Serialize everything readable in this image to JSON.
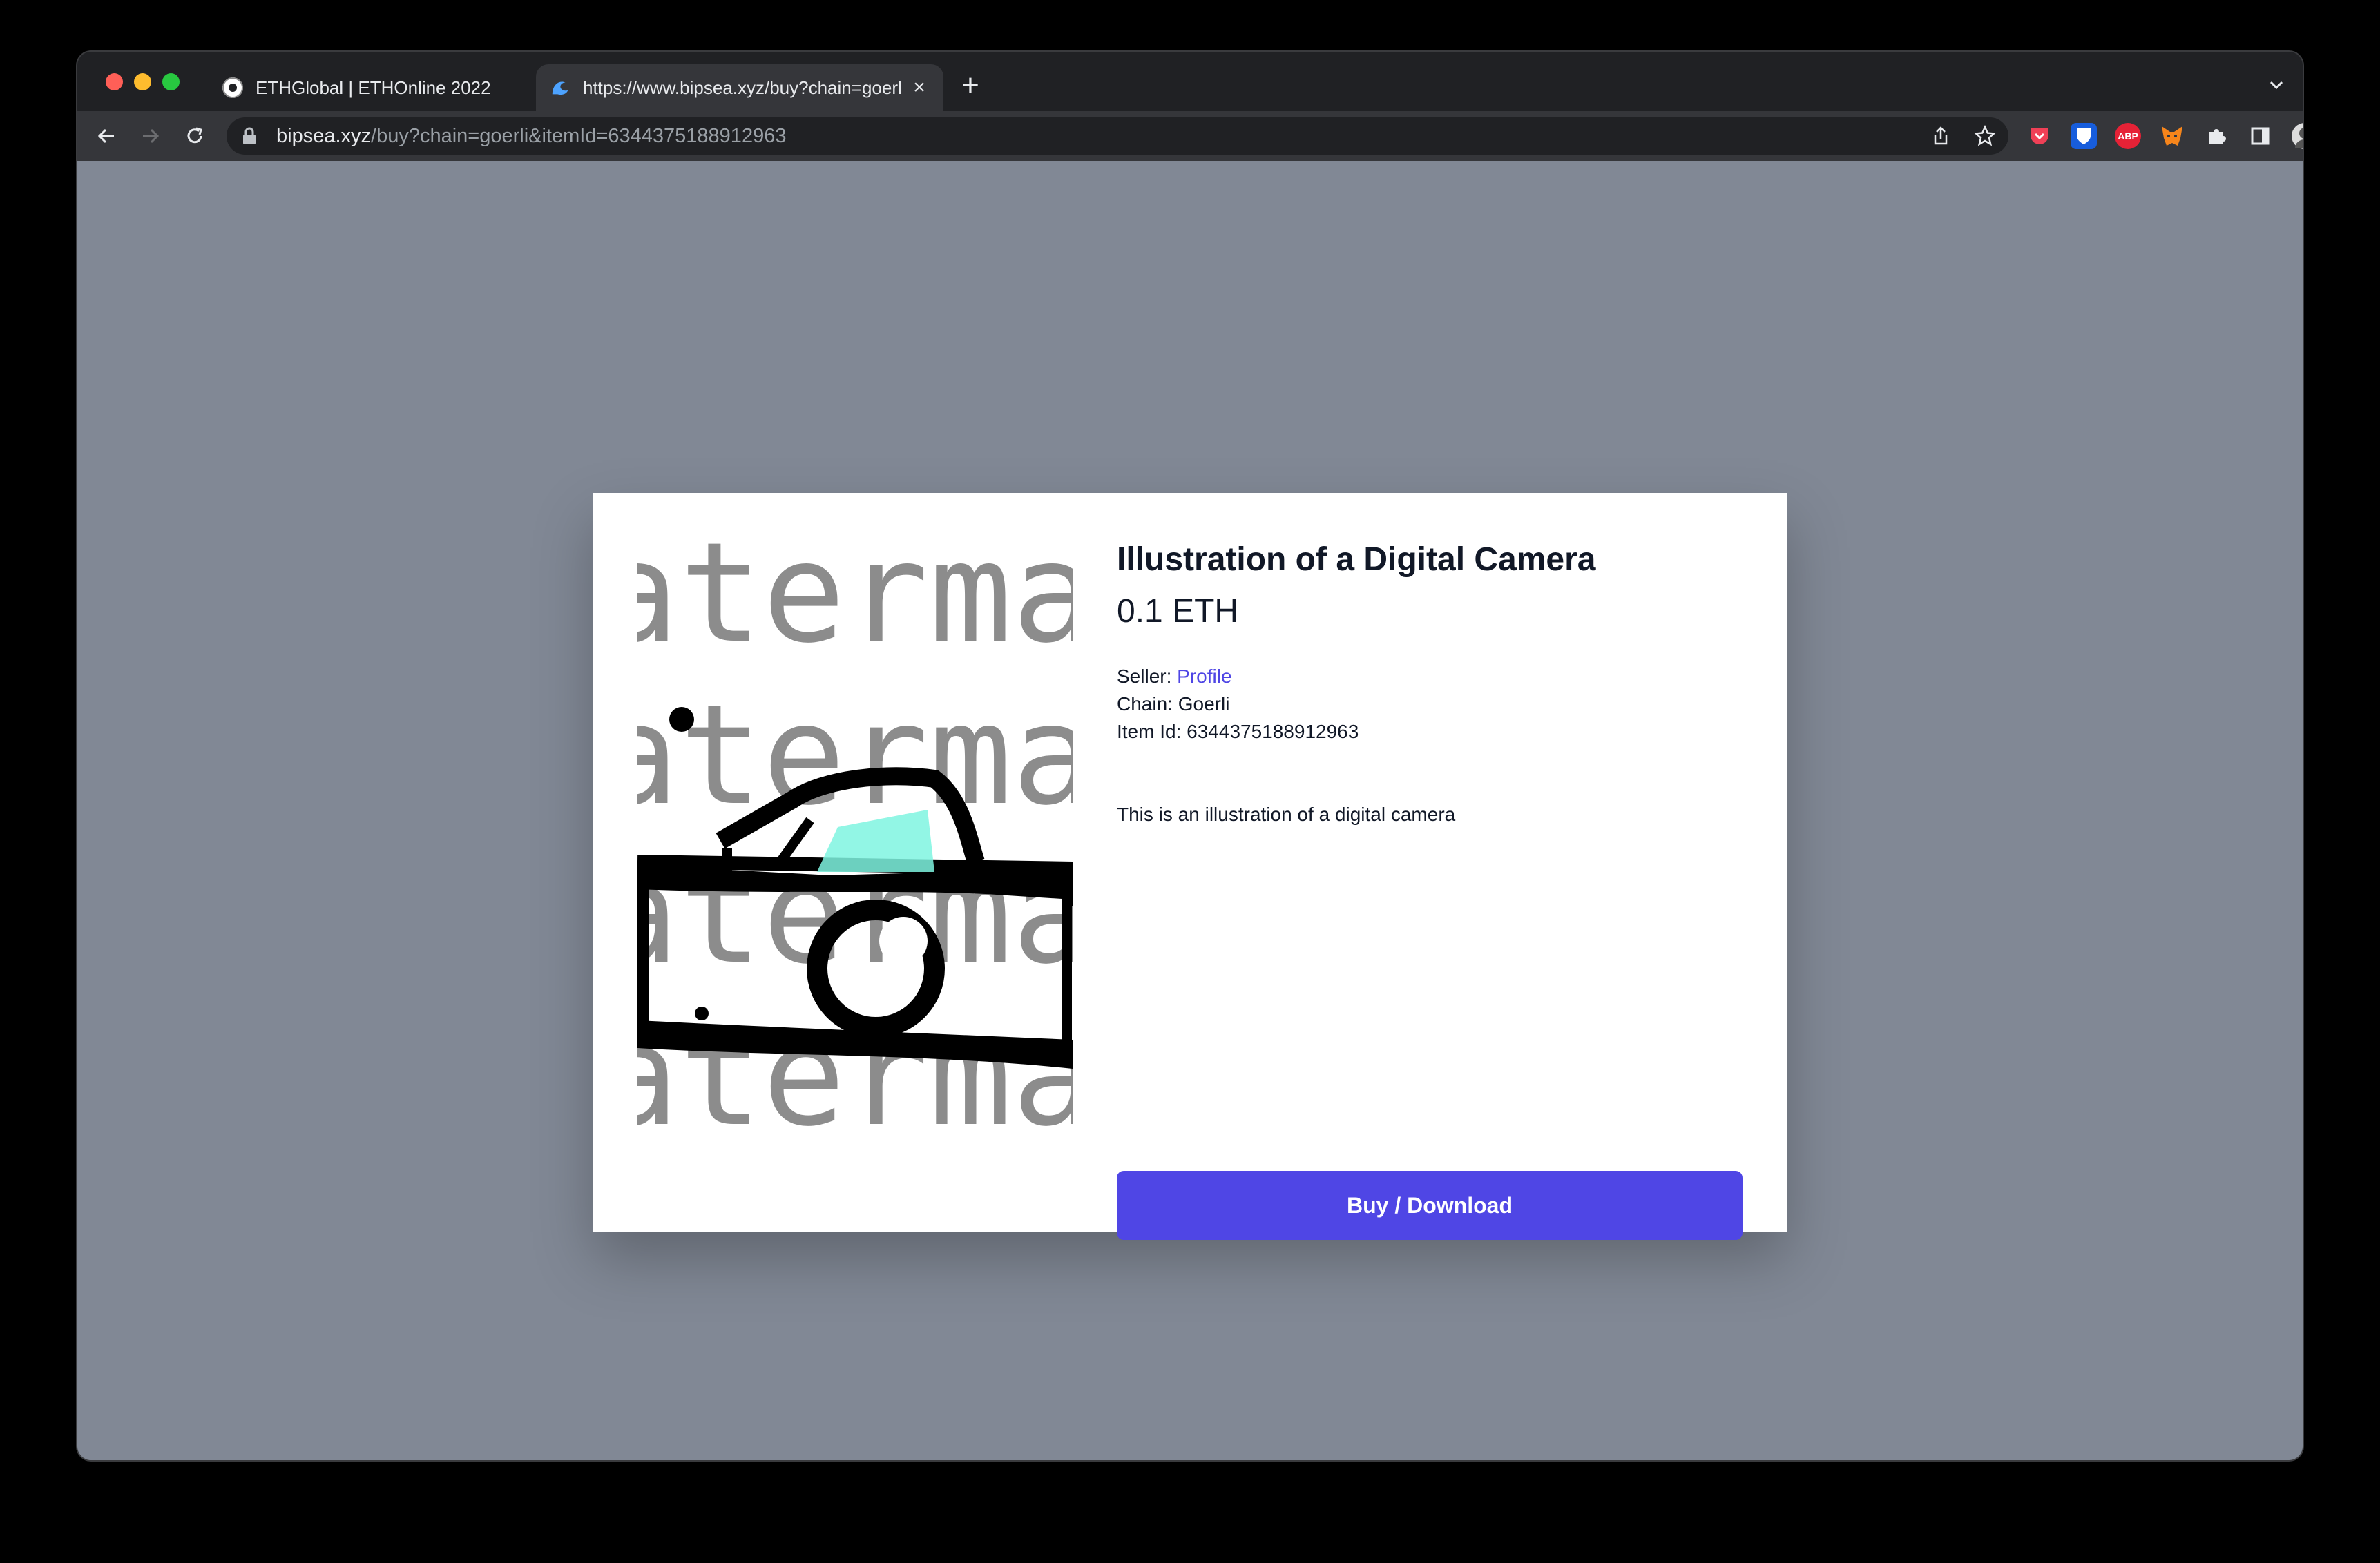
{
  "browser": {
    "tabs": [
      {
        "title": "ETHGlobal | ETHOnline 2022",
        "favicon": "ethglobal-icon",
        "active": false
      },
      {
        "title": "https://www.bipsea.xyz/buy?chain=goerli&itemId=6344375188912963",
        "favicon": "wave-icon",
        "active": true
      }
    ],
    "url_host": "bipsea.xyz",
    "url_path": "/buy?chain=goerli&itemId=6344375188912963",
    "extensions": [
      {
        "name": "pocket-icon",
        "color": "#ef4056"
      },
      {
        "name": "bitwarden-icon",
        "color": "#175ddc"
      },
      {
        "name": "adblock-icon",
        "color": "#e62236",
        "label": "ABP"
      },
      {
        "name": "metamask-icon",
        "color": "#f6851b"
      }
    ]
  },
  "item": {
    "image_watermark": "aterma",
    "title": "Illustration of a Digital Camera",
    "price": "0.1 ETH",
    "seller_label": "Seller:",
    "seller_link": "Profile",
    "chain_label": "Chain:",
    "chain_value": "Goerli",
    "item_id_label": "Item Id:",
    "item_id_value": "6344375188912963",
    "description": "This is an illustration of a digital camera",
    "buy_button": "Buy / Download"
  },
  "colors": {
    "accent": "#4f46e5",
    "link": "#4f46e5",
    "backdrop": "#9ca3af"
  }
}
